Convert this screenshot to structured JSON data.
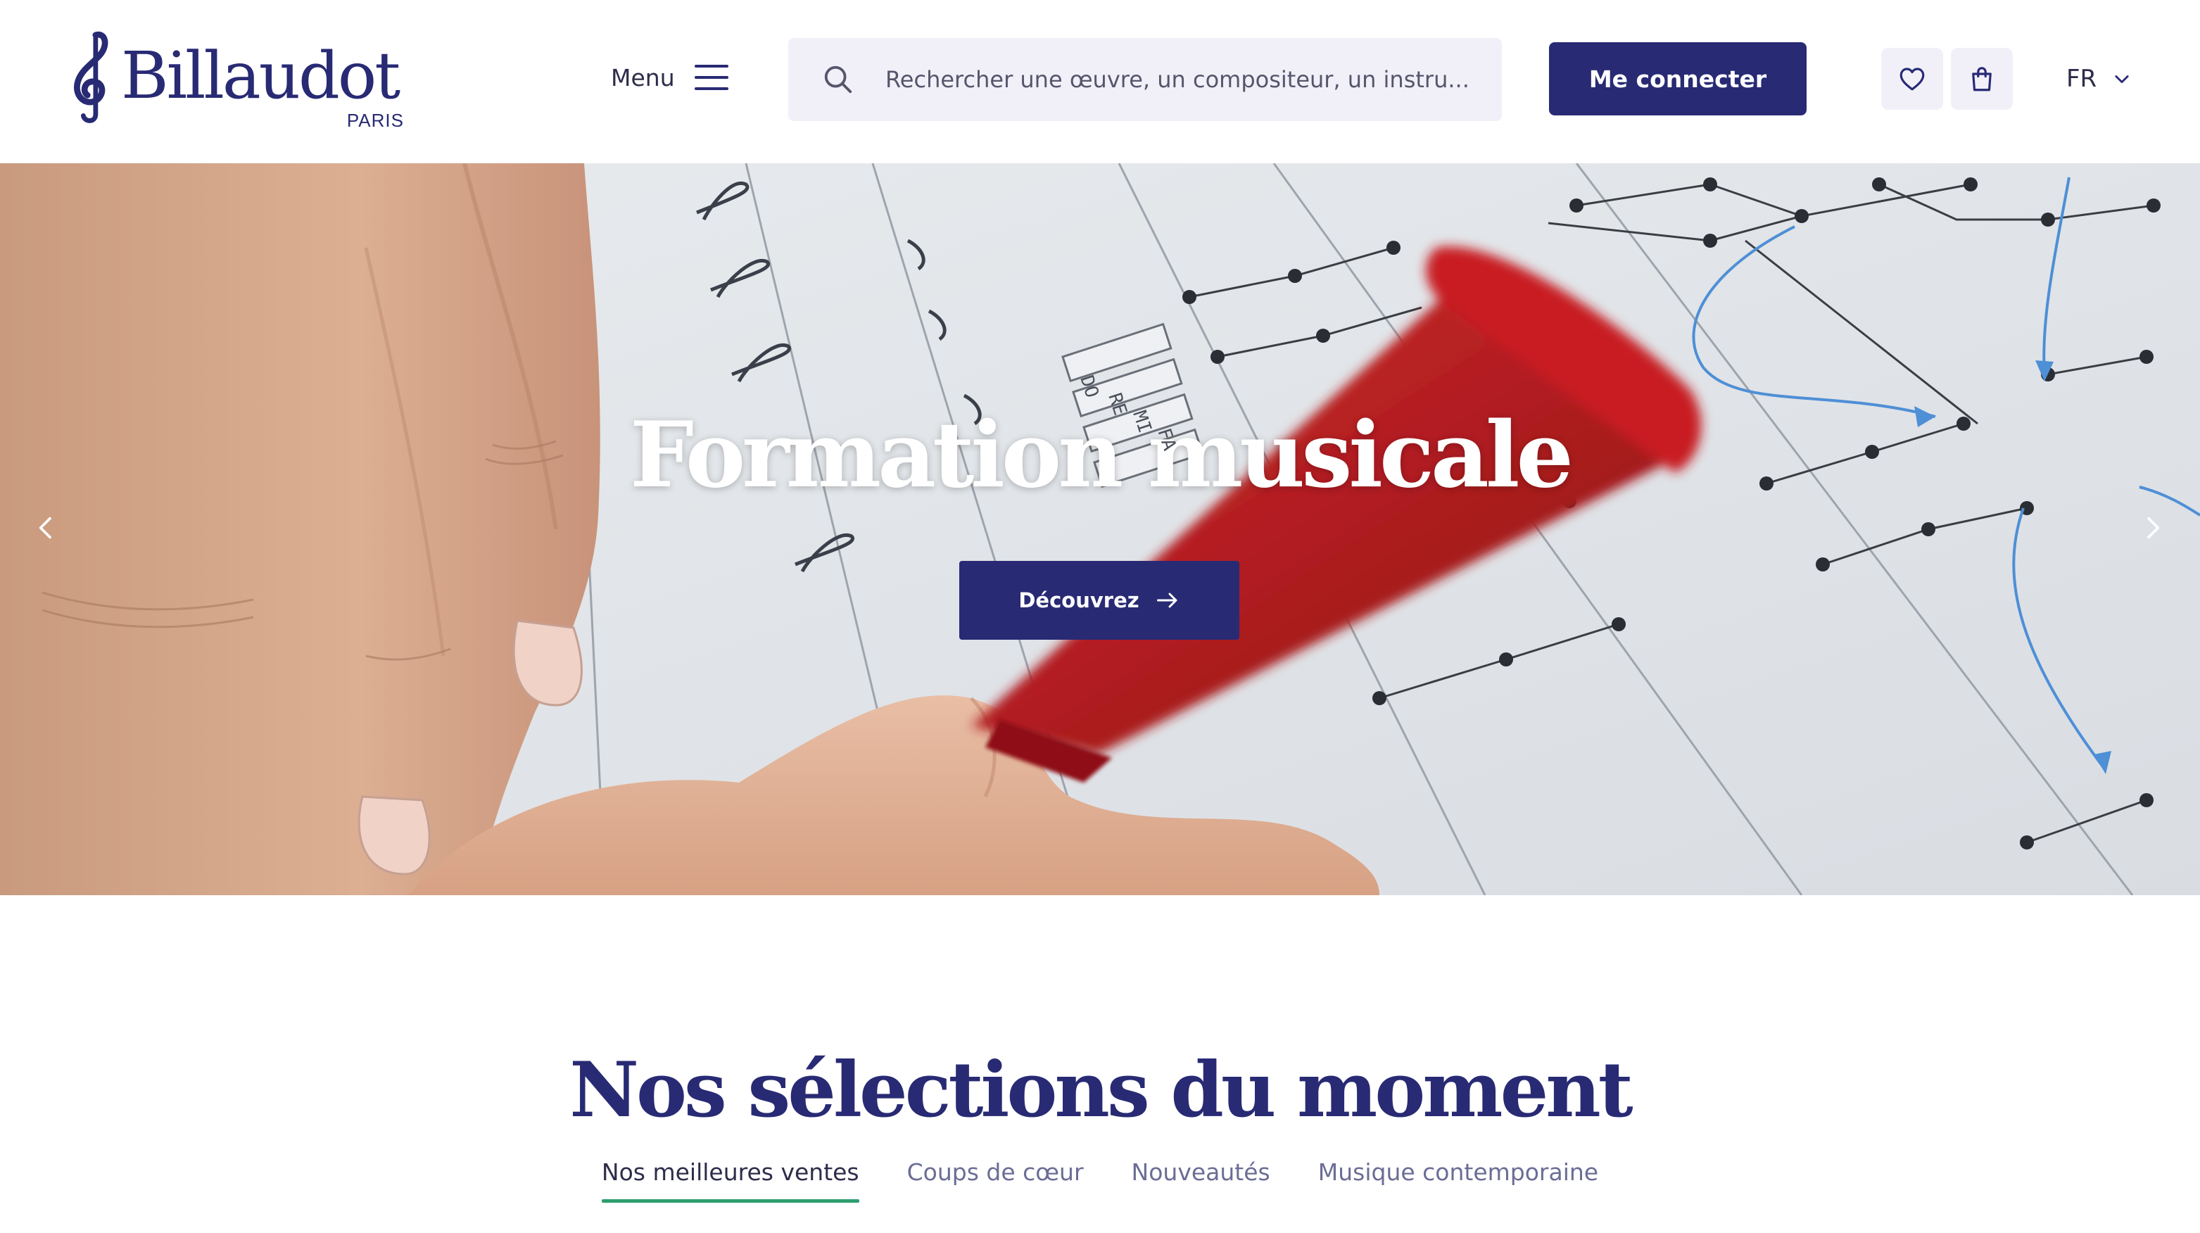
{
  "brand": {
    "name": "Billaudot",
    "city": "PARIS"
  },
  "header": {
    "menu_label": "Menu",
    "search_placeholder": "Rechercher une œuvre, un compositeur, un instru...",
    "login_label": "Me connecter",
    "language": "FR"
  },
  "hero": {
    "title": "Formation musicale",
    "cta_label": "Découvrez",
    "score_labels": [
      "DO",
      "RE",
      "MI",
      "FA"
    ]
  },
  "selections": {
    "title": "Nos sélections du moment",
    "tabs": [
      {
        "label": "Nos meilleures ventes",
        "active": true
      },
      {
        "label": "Coups de cœur",
        "active": false
      },
      {
        "label": "Nouveautés",
        "active": false
      },
      {
        "label": "Musique contemporaine",
        "active": false
      }
    ]
  },
  "colors": {
    "brand_navy": "#282a74",
    "search_bg": "#f1f0f8",
    "tab_active_underline": "#2f9e6e",
    "pen_red": "#b3191d"
  },
  "icons": [
    "treble-clef-icon",
    "hamburger-icon",
    "search-icon",
    "heart-icon",
    "shopping-bag-icon",
    "chevron-down-icon",
    "arrow-right-icon",
    "chevron-left-icon",
    "chevron-right-icon"
  ]
}
